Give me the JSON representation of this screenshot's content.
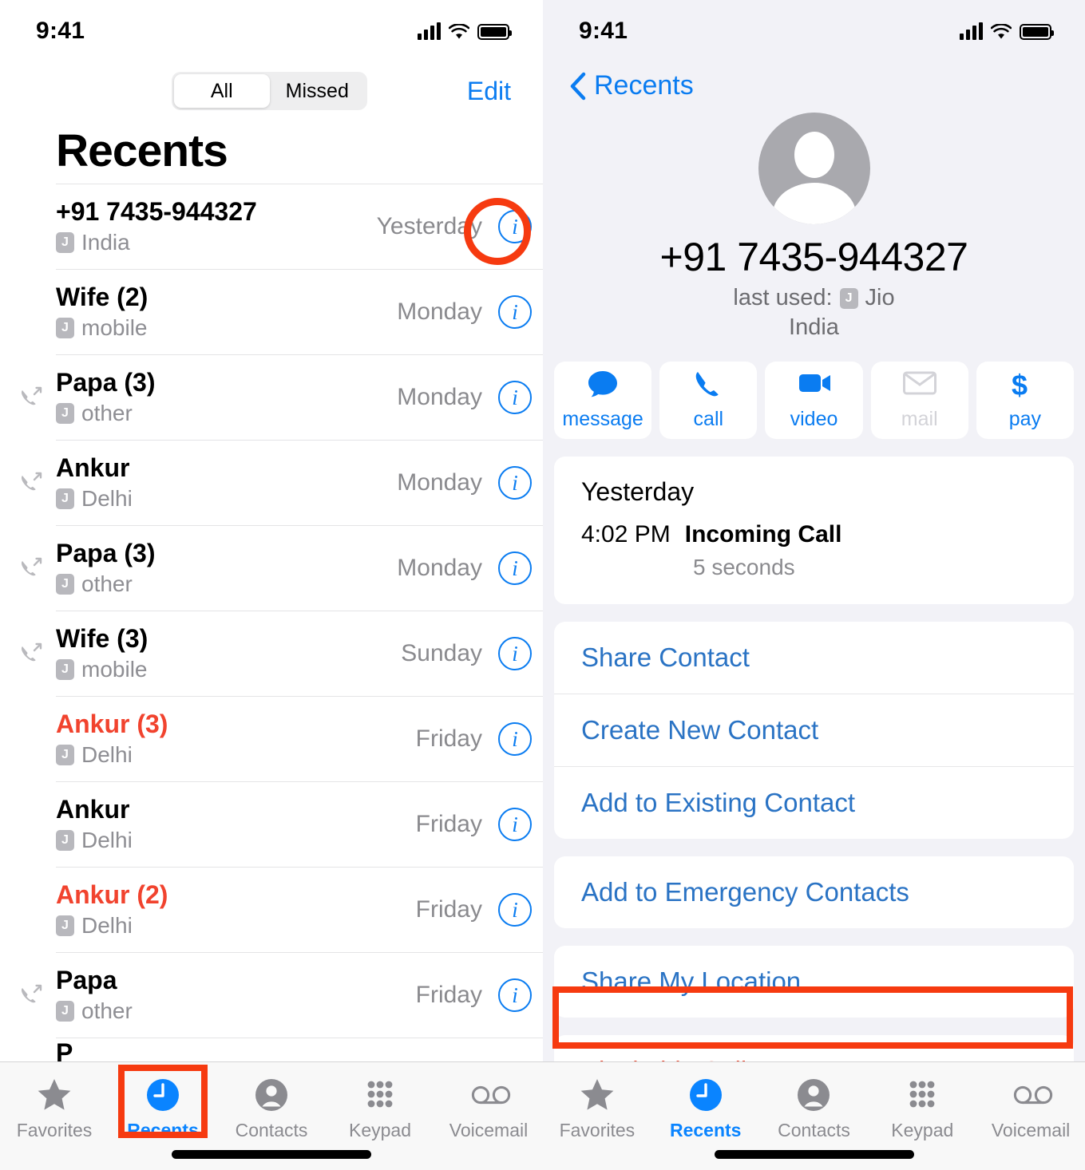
{
  "left_screen": {
    "status_bar": {
      "time": "9:41",
      "signal_icon": "cellular-bars-icon",
      "wifi_icon": "wifi-icon",
      "battery_icon": "battery-icon"
    },
    "segmented_control": {
      "options": [
        "All",
        "Missed"
      ],
      "selected": "All"
    },
    "edit_label": "Edit",
    "title": "Recents",
    "calls": [
      {
        "name": "+91 7435-944327",
        "sim": "J",
        "detail": "India",
        "time": "Yesterday",
        "missed": false,
        "outgoing": false
      },
      {
        "name": "Wife (2)",
        "sim": "J",
        "detail": "mobile",
        "time": "Monday",
        "missed": false,
        "outgoing": false
      },
      {
        "name": "Papa (3)",
        "sim": "J",
        "detail": "other",
        "time": "Monday",
        "missed": false,
        "outgoing": true
      },
      {
        "name": "Ankur",
        "sim": "J",
        "detail": "Delhi",
        "time": "Monday",
        "missed": false,
        "outgoing": true
      },
      {
        "name": "Papa (3)",
        "sim": "J",
        "detail": "other",
        "time": "Monday",
        "missed": false,
        "outgoing": true
      },
      {
        "name": "Wife (3)",
        "sim": "J",
        "detail": "mobile",
        "time": "Sunday",
        "missed": false,
        "outgoing": true
      },
      {
        "name": "Ankur (3)",
        "sim": "J",
        "detail": "Delhi",
        "time": "Friday",
        "missed": true,
        "outgoing": false
      },
      {
        "name": "Ankur",
        "sim": "J",
        "detail": "Delhi",
        "time": "Friday",
        "missed": false,
        "outgoing": false
      },
      {
        "name": "Ankur (2)",
        "sim": "J",
        "detail": "Delhi",
        "time": "Friday",
        "missed": true,
        "outgoing": false
      },
      {
        "name": "Papa",
        "sim": "J",
        "detail": "other",
        "time": "Friday",
        "missed": false,
        "outgoing": true
      }
    ],
    "info_button_glyph": "i",
    "tabs": [
      {
        "label": "Favorites",
        "icon": "star-icon",
        "active": false
      },
      {
        "label": "Recents",
        "icon": "clock-icon",
        "active": true
      },
      {
        "label": "Contacts",
        "icon": "person-icon",
        "active": false
      },
      {
        "label": "Keypad",
        "icon": "keypad-icon",
        "active": false
      },
      {
        "label": "Voicemail",
        "icon": "voicemail-icon",
        "active": false
      }
    ]
  },
  "right_screen": {
    "status_bar": {
      "time": "9:41",
      "signal_icon": "cellular-bars-icon",
      "wifi_icon": "wifi-icon",
      "battery_icon": "battery-icon"
    },
    "back_label": "Recents",
    "contact": {
      "number": "+91 7435-944327",
      "last_used_prefix": "last used:",
      "sim": "J",
      "carrier": "Jio",
      "region": "India"
    },
    "actions": [
      {
        "label": "message",
        "icon": "message-bubble-icon",
        "disabled": false
      },
      {
        "label": "call",
        "icon": "phone-icon",
        "disabled": false
      },
      {
        "label": "video",
        "icon": "video-camera-icon",
        "disabled": false
      },
      {
        "label": "mail",
        "icon": "envelope-icon",
        "disabled": true
      },
      {
        "label": "pay",
        "icon": "dollar-icon",
        "disabled": false
      }
    ],
    "history": {
      "day": "Yesterday",
      "time": "4:02 PM",
      "type": "Incoming Call",
      "duration": "5 seconds"
    },
    "link_group_1": [
      "Share Contact",
      "Create New Contact",
      "Add to Existing Contact"
    ],
    "link_group_2": [
      "Add to Emergency Contacts"
    ],
    "link_group_3": [
      "Share My Location"
    ],
    "link_group_4": [
      "Block this Caller"
    ],
    "tabs": [
      {
        "label": "Favorites",
        "icon": "star-icon",
        "active": false
      },
      {
        "label": "Recents",
        "icon": "clock-icon",
        "active": true
      },
      {
        "label": "Contacts",
        "icon": "person-icon",
        "active": false
      },
      {
        "label": "Keypad",
        "icon": "keypad-icon",
        "active": false
      },
      {
        "label": "Voicemail",
        "icon": "voicemail-icon",
        "active": false
      }
    ]
  },
  "annotations": {
    "color": "#f63a10",
    "items": [
      {
        "shape": "circle",
        "target": "info-button-first-row"
      },
      {
        "shape": "box",
        "target": "recents-tab"
      },
      {
        "shape": "box",
        "target": "block-this-caller-row"
      }
    ]
  }
}
